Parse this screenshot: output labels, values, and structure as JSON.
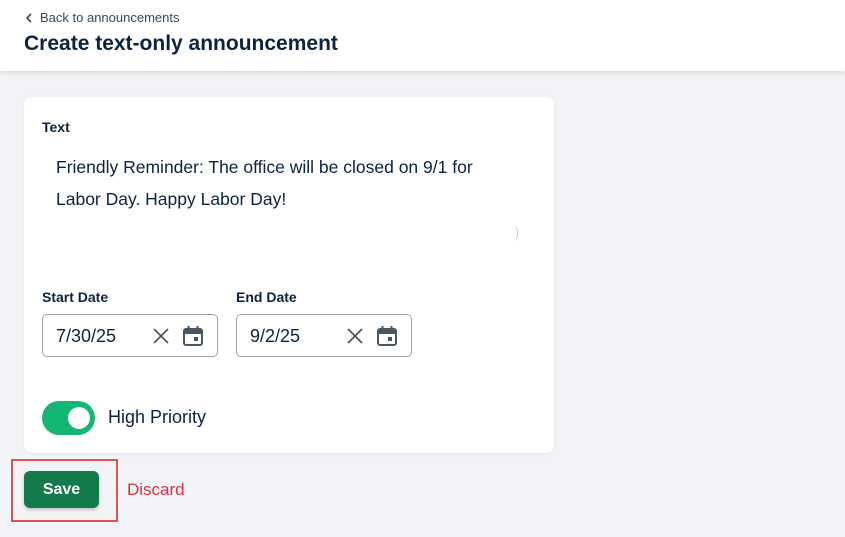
{
  "header": {
    "back_label": "Back to announcements",
    "title": "Create text-only announcement"
  },
  "form": {
    "text_label": "Text",
    "text_value": "Friendly Reminder: The office will be closed on 9/1 for\nLabor Day. Happy Labor Day!",
    "start_date_label": "Start Date",
    "start_date_value": "7/30/25",
    "end_date_label": "End Date",
    "end_date_value": "9/2/25",
    "priority_label": "High Priority",
    "priority_on": true
  },
  "actions": {
    "save_label": "Save",
    "discard_label": "Discard"
  },
  "colors": {
    "accent_green": "#137a4b",
    "toggle_green": "#13b673",
    "discard_red": "#d6343f",
    "highlight_red": "#e05252",
    "title_navy": "#0c2340"
  },
  "icons": [
    "chevron-left-icon",
    "close-icon",
    "calendar-icon"
  ]
}
